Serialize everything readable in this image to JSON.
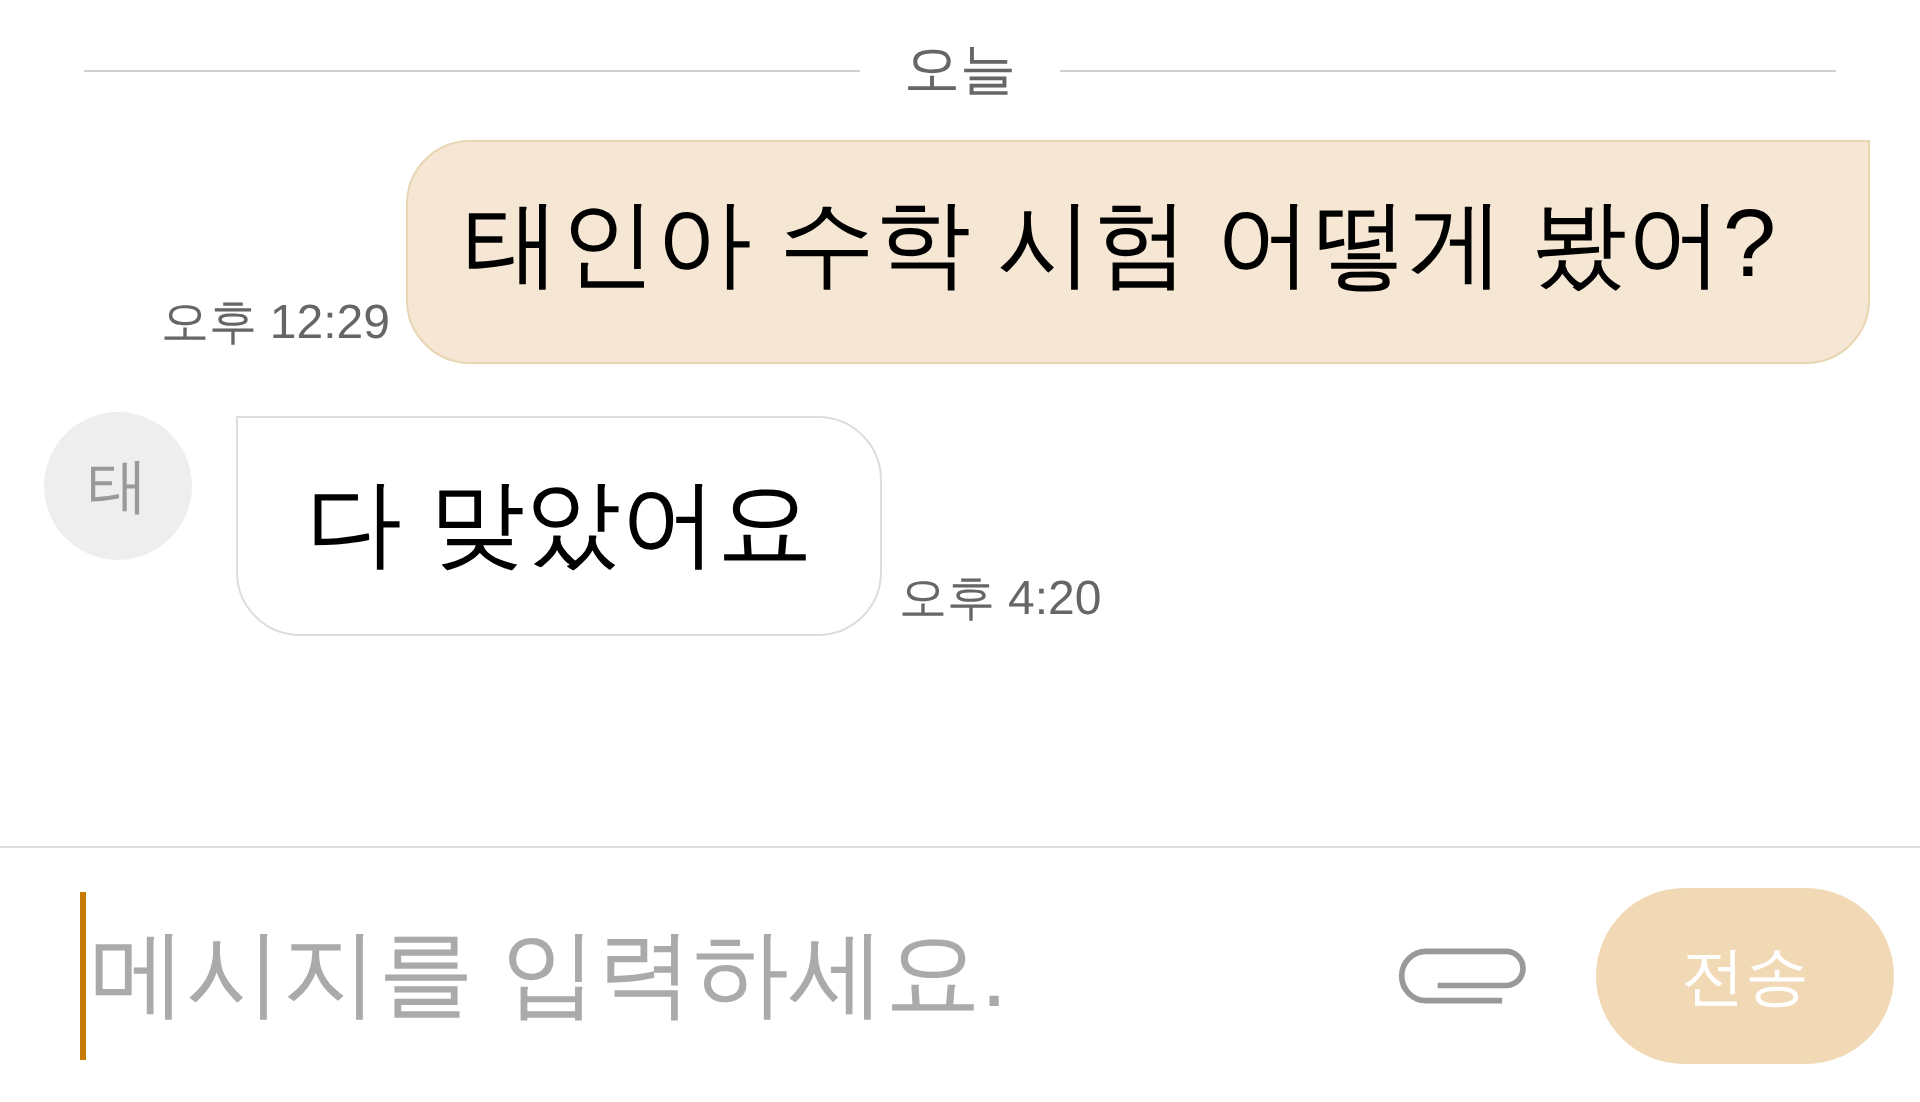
{
  "date_divider": "오늘",
  "messages": [
    {
      "kind": "sent",
      "text": "태인아 수학 시험 어떻게 봤어?",
      "time": "오후 12:29"
    },
    {
      "kind": "received",
      "avatar": "태",
      "text": "다 맞았어요",
      "time": "오후 4:20"
    }
  ],
  "composer": {
    "placeholder": "메시지를 입력하세요.",
    "send_label": "전송"
  }
}
